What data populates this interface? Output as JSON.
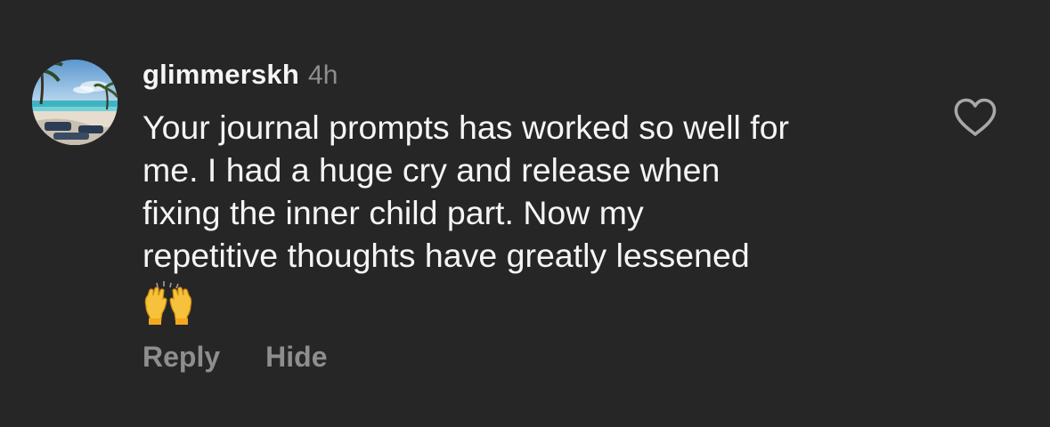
{
  "comment": {
    "username": "glimmerskh",
    "timestamp": "4h",
    "text_lines": [
      "Your journal prompts has worked so well for",
      "me. I had a huge cry and release when",
      "fixing the inner child part. Now my",
      "repetitive thoughts have greatly lessened"
    ],
    "emoji": "🙌",
    "actions": {
      "reply": "Reply",
      "hide": "Hide"
    },
    "like_icon": "heart-outline-icon"
  },
  "colors": {
    "background": "#262626",
    "primary_text": "#f5f5f5",
    "secondary_text": "#8e8e8e"
  }
}
